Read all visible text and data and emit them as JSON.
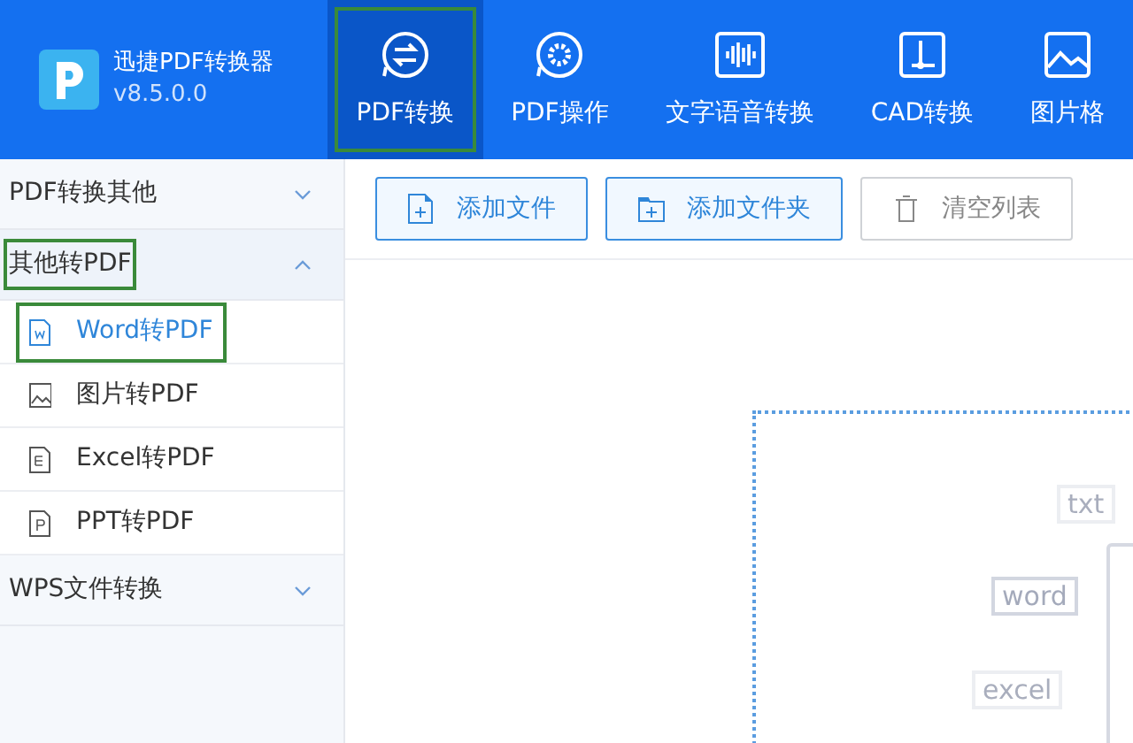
{
  "app": {
    "title": "迅捷PDF转换器",
    "version": "v8.5.0.0"
  },
  "nav": [
    {
      "label": "PDF转换",
      "selected": true,
      "highlighted": true
    },
    {
      "label": "PDF操作",
      "selected": false,
      "highlighted": false
    },
    {
      "label": "文字语音转换",
      "selected": false,
      "highlighted": false
    },
    {
      "label": "CAD转换",
      "selected": false,
      "highlighted": false
    },
    {
      "label": "图片格",
      "selected": false,
      "highlighted": false
    }
  ],
  "sidebar": [
    {
      "label": "PDF转换其他",
      "expanded": false,
      "highlighted": false
    },
    {
      "label": "其他转PDF",
      "expanded": true,
      "highlighted": true,
      "children": [
        {
          "label": "Word转PDF",
          "selected": true,
          "highlighted": true
        },
        {
          "label": "图片转PDF",
          "selected": false,
          "highlighted": false
        },
        {
          "label": "Excel转PDF",
          "selected": false,
          "highlighted": false
        },
        {
          "label": "PPT转PDF",
          "selected": false,
          "highlighted": false
        }
      ]
    },
    {
      "label": "WPS文件转换",
      "expanded": false,
      "highlighted": false
    }
  ],
  "toolbar": [
    {
      "label": "添加文件",
      "disabled": false
    },
    {
      "label": "添加文件夹",
      "disabled": false
    },
    {
      "label": "清空列表",
      "disabled": true
    }
  ],
  "drop_zone": {
    "tags": [
      "txt",
      "word",
      "excel"
    ]
  }
}
